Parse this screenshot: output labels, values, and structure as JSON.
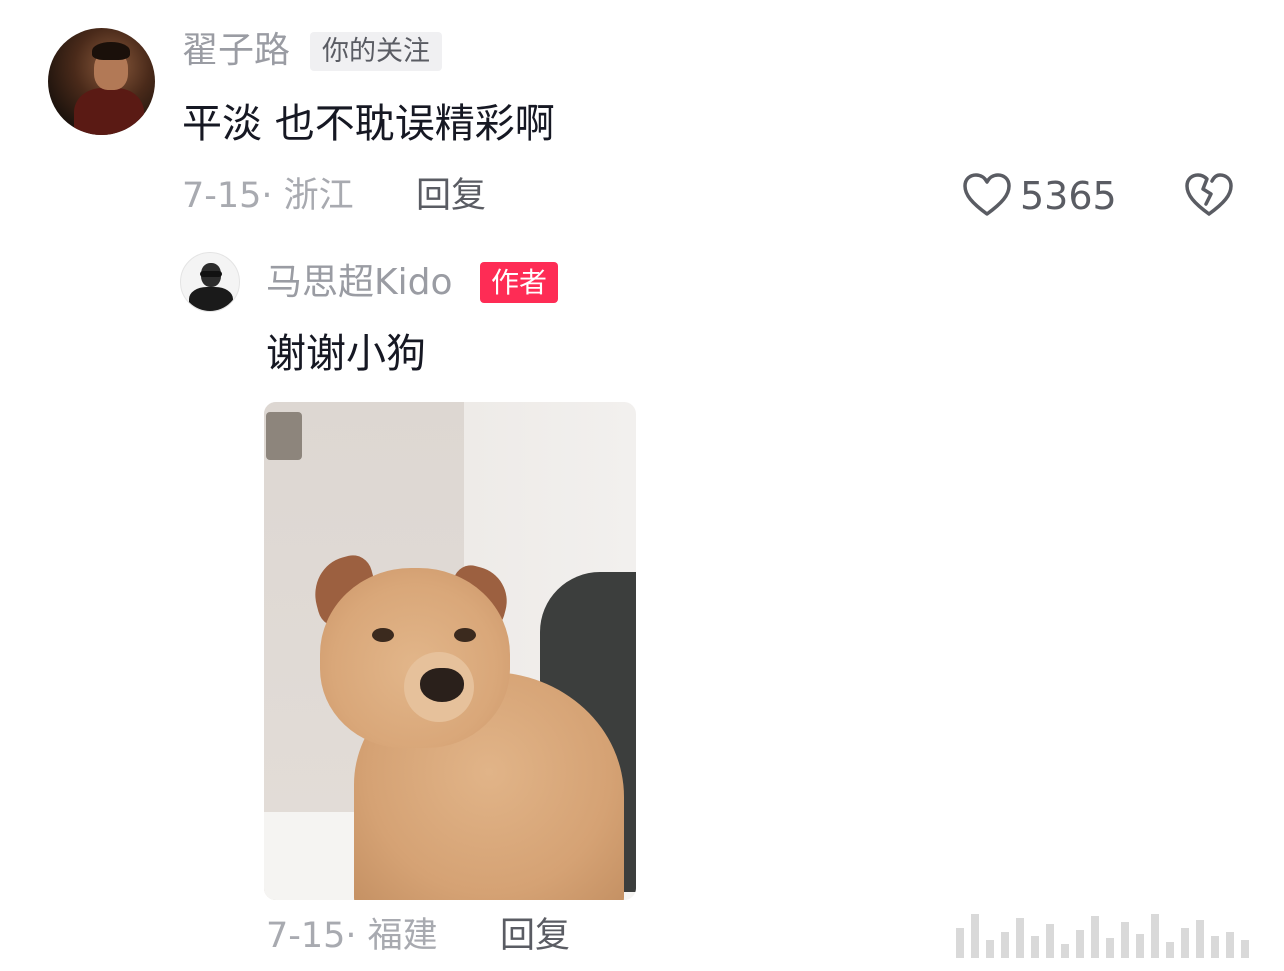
{
  "comment": {
    "username": "翟子路",
    "follow_badge": "你的关注",
    "text": "平淡 也不耽误精彩啊",
    "date_location": "7-15· 浙江",
    "reply_label": "回复",
    "like_count": "5365",
    "icons": {
      "like": "heart-outline-icon",
      "dislike": "broken-heart-icon"
    }
  },
  "reply": {
    "username": "马思超Kido",
    "author_badge": "作者",
    "text": "谢谢小狗",
    "date_location": "7-15· 福建",
    "reply_label": "回复"
  },
  "colors": {
    "author_badge": "#fe2c55",
    "text_primary": "#161823",
    "text_secondary": "#a8aab0"
  }
}
